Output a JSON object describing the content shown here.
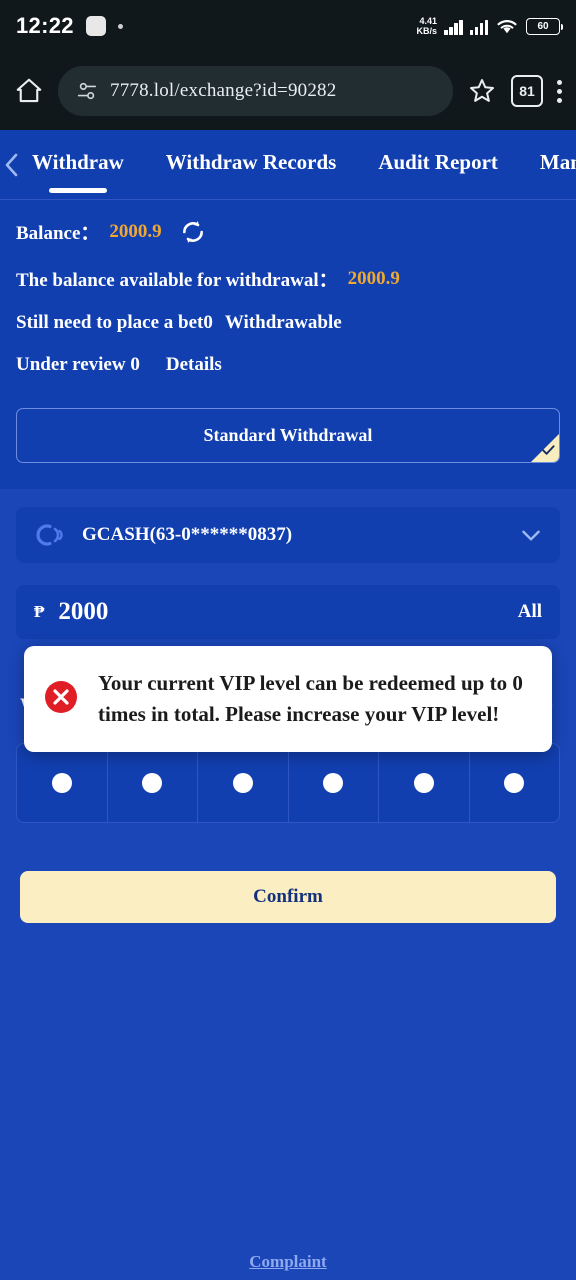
{
  "status_bar": {
    "time": "12:22",
    "network_speed": "4.41",
    "network_speed_unit": "KB/s",
    "battery_level": "60"
  },
  "browser": {
    "url": "7778.lol/exchange?id=90282",
    "tab_count": "81"
  },
  "tabs": [
    {
      "label": "Withdraw",
      "active": true
    },
    {
      "label": "Withdraw Records",
      "active": false
    },
    {
      "label": "Audit Report",
      "active": false
    },
    {
      "label": "Manag",
      "active": false
    }
  ],
  "balance": {
    "label": "Balance：",
    "value": "2000.9",
    "available_label": "The balance available for withdrawal：",
    "available_value": "2000.9",
    "bet_requirement": "Still need to place a bet0",
    "withdrawable_label": "Withdrawable",
    "under_review_label": "Under review 0",
    "details_label": "Details"
  },
  "withdraw_type": {
    "standard_label": "Standard Withdrawal",
    "selected": true
  },
  "payment_method": {
    "label": "GCASH(63-0******0837)"
  },
  "amount": {
    "currency": "₱",
    "value": "2000",
    "all_label": "All"
  },
  "password": {
    "label": "Withdrawal Password",
    "digits": [
      "•",
      "•",
      "•",
      "•",
      "•",
      "•"
    ]
  },
  "confirm": {
    "label": "Confirm"
  },
  "footer": {
    "complaint_label": "Complaint"
  },
  "modal": {
    "message": "Your current VIP level can be redeemed up to 0 times in total. Please increase your VIP level!"
  },
  "colors": {
    "page_bg": "#1a46b8",
    "panel_bg": "#123fb0",
    "accent_amount": "#f0a830",
    "confirm_bg": "#fbeec2",
    "confirm_text": "#13307c",
    "error_icon": "#e01e26",
    "link": "#8fa9ef"
  }
}
